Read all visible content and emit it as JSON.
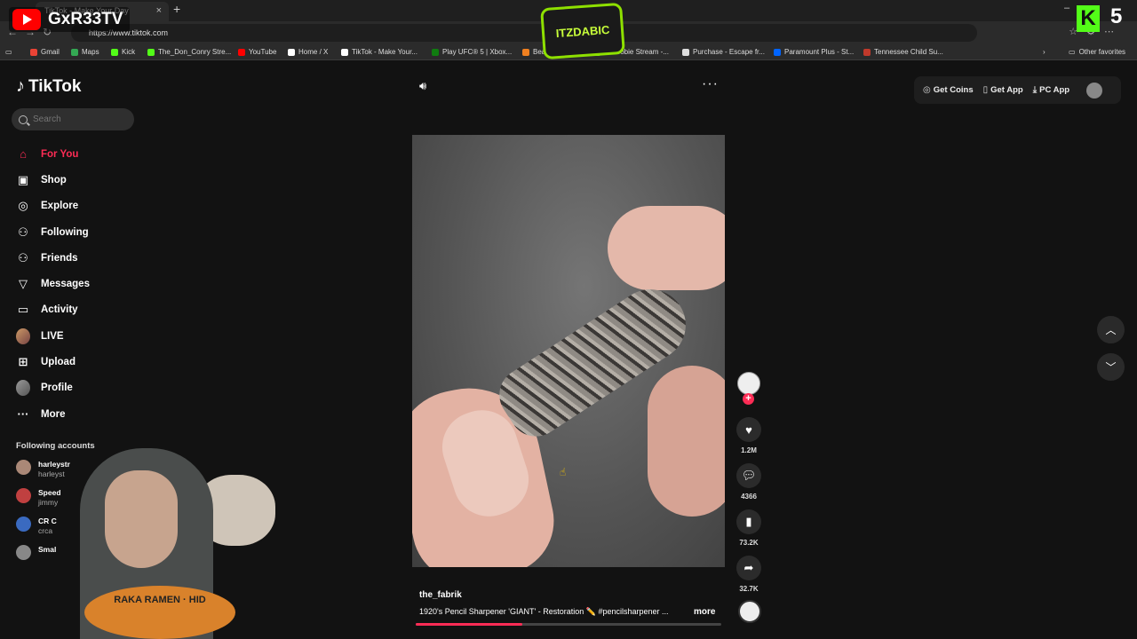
{
  "browser": {
    "tab_title": "TikTok - Make Your Day",
    "new_tab": "+",
    "close_tab": "×",
    "url": "https://www.tiktok.com",
    "bookmarks": [
      {
        "label": "Gmail",
        "color": "#ea4335"
      },
      {
        "label": "Maps",
        "color": "#34a853"
      },
      {
        "label": "Kick",
        "color": "#53fc18"
      },
      {
        "label": "The_Don_Conry Stre...",
        "color": "#53fc18"
      },
      {
        "label": "YouTube",
        "color": "#ff0000"
      },
      {
        "label": "Home / X",
        "color": "#ffffff"
      },
      {
        "label": "TikTok - Make Your...",
        "color": "#ffffff"
      },
      {
        "label": "Play UFC® 5 | Xbox...",
        "color": "#107c10"
      },
      {
        "label": "BeamNG...",
        "color": "#f08020"
      },
      {
        "label": "itzDoobie Stream -...",
        "color": "#53fc18"
      },
      {
        "label": "Purchase - Escape fr...",
        "color": "#dddddd"
      },
      {
        "label": "Paramount Plus - St...",
        "color": "#0064ff"
      },
      {
        "label": "Tennessee Child Su...",
        "color": "#c0392b"
      }
    ],
    "other_favorites": "Other favorites"
  },
  "overlays": {
    "youtube_channel": "GxR33TV",
    "itz_logo": "ITZDABIC",
    "kick_letter": "K",
    "kick_number": "5"
  },
  "sidebar": {
    "logo_text": "TikTok",
    "search_placeholder": "Search",
    "nav": [
      {
        "label": "For You",
        "icon": "home-icon",
        "glyph": "⌂",
        "active": true
      },
      {
        "label": "Shop",
        "icon": "shop-icon",
        "glyph": "▣"
      },
      {
        "label": "Explore",
        "icon": "compass-icon",
        "glyph": "◎"
      },
      {
        "label": "Following",
        "icon": "following-icon",
        "glyph": "⚇"
      },
      {
        "label": "Friends",
        "icon": "friends-icon",
        "glyph": "⚇"
      },
      {
        "label": "Messages",
        "icon": "messages-icon",
        "glyph": "▽"
      },
      {
        "label": "Activity",
        "icon": "activity-icon",
        "glyph": "▭"
      },
      {
        "label": "LIVE",
        "icon": "live-avatar",
        "glyph": ""
      },
      {
        "label": "Upload",
        "icon": "upload-icon",
        "glyph": "⊞"
      },
      {
        "label": "Profile",
        "icon": "profile-avatar",
        "glyph": ""
      },
      {
        "label": "More",
        "icon": "more-icon",
        "glyph": "···"
      }
    ],
    "following_title": "Following accounts",
    "following_accounts": [
      {
        "name": "harleystr",
        "handle": "harleyst"
      },
      {
        "name": "Speed",
        "handle": "jimmy"
      },
      {
        "name": "CR C",
        "handle": "crca"
      },
      {
        "name": "Smal",
        "handle": ""
      }
    ]
  },
  "webcam": {
    "shirt_text": "RAKA RAMEN · HID"
  },
  "topbar": {
    "get_coins": "Get Coins",
    "get_app": "Get App",
    "pc_app": "PC App"
  },
  "video": {
    "author": "the_fabrik",
    "description": "1920's Pencil Sharpener 'GIANT' - Restoration ✏️ #pencilsharpener ...",
    "more": "more",
    "likes": "1.2M",
    "comments": "4366",
    "saves": "73.2K",
    "shares": "32.7K",
    "progress": 0.35
  }
}
